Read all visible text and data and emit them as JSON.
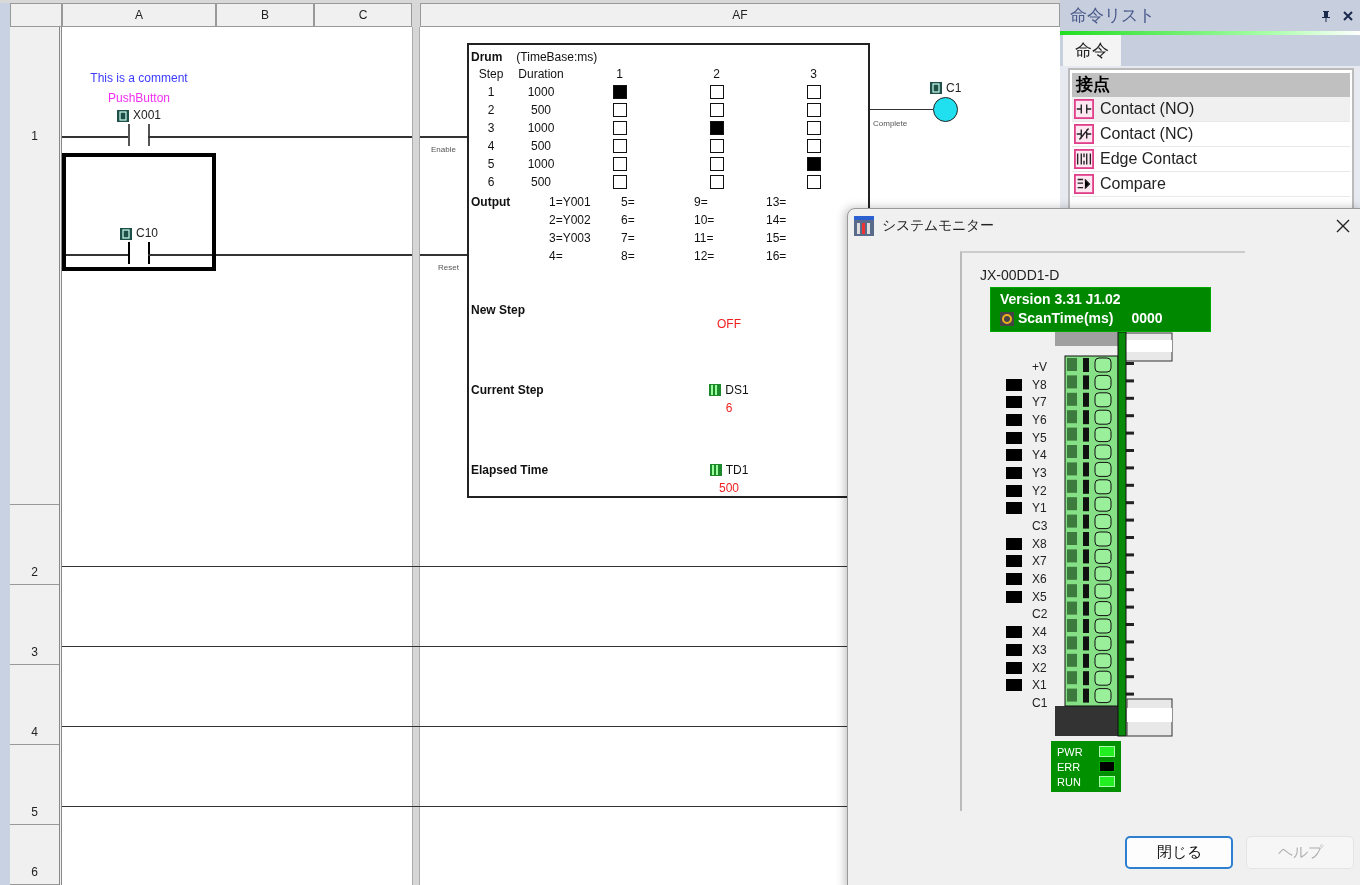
{
  "ladder": {
    "columns": [
      "A",
      "B",
      "C",
      "AF"
    ],
    "row_numbers": [
      "1",
      "2",
      "3",
      "4",
      "5",
      "6"
    ],
    "comment": "This is a comment",
    "contacts": [
      {
        "nickname": "PushButton",
        "address": "X001",
        "selected": false
      },
      {
        "address": "C10",
        "selected": true
      }
    ],
    "input_labels": [
      "Enable",
      "Reset"
    ],
    "output_label": "Complete",
    "coil": {
      "address": "C1",
      "on": true
    },
    "drum": {
      "title": "Drum",
      "time_base": "(TimeBase:ms)",
      "step_heading": "Step",
      "duration_heading": "Duration",
      "output_headings": [
        "1",
        "2",
        "3"
      ],
      "steps": [
        {
          "step": "1",
          "duration": "1000",
          "outputs": [
            true,
            false,
            false
          ]
        },
        {
          "step": "2",
          "duration": "500",
          "outputs": [
            false,
            false,
            false
          ]
        },
        {
          "step": "3",
          "duration": "1000",
          "outputs": [
            false,
            true,
            false
          ]
        },
        {
          "step": "4",
          "duration": "500",
          "outputs": [
            false,
            false,
            false
          ]
        },
        {
          "step": "5",
          "duration": "1000",
          "outputs": [
            false,
            false,
            true
          ]
        },
        {
          "step": "6",
          "duration": "500",
          "outputs": [
            false,
            false,
            false
          ]
        }
      ],
      "output_label": "Output",
      "output_map": [
        "1=Y001",
        "2=Y002",
        "3=Y003",
        "4=",
        "5=",
        "6=",
        "7=",
        "8=",
        "9=",
        "10=",
        "11=",
        "12=",
        "13=",
        "14=",
        "15=",
        "16="
      ],
      "fields": [
        {
          "label": "New Step",
          "value": "OFF"
        },
        {
          "label": "Current Step",
          "address": "DS1",
          "value": "6"
        },
        {
          "label": "Elapsed Time",
          "address": "TD1",
          "value": "500"
        }
      ]
    }
  },
  "instruction_list": {
    "title": "命令リスト",
    "tabs": [
      {
        "label": "命令",
        "selected": true
      }
    ],
    "category": "接点",
    "items": [
      {
        "label": "Contact (NO)",
        "kind": "no",
        "selected": true
      },
      {
        "label": "Contact (NC)",
        "kind": "nc",
        "selected": false
      },
      {
        "label": "Edge Contact",
        "kind": "edge",
        "selected": false
      },
      {
        "label": "Compare",
        "kind": "compare",
        "selected": false
      }
    ]
  },
  "system_monitor": {
    "title": "システムモニター",
    "model": "JX-00DD1-D",
    "version": "Version 3.31 J1.02",
    "scan_time_label": "ScanTime(ms)",
    "scan_time": "0000",
    "terminals": [
      {
        "label": "+V",
        "kind": "common"
      },
      {
        "label": "Y8",
        "kind": "io",
        "on": false
      },
      {
        "label": "Y7",
        "kind": "io",
        "on": false
      },
      {
        "label": "Y6",
        "kind": "io",
        "on": false
      },
      {
        "label": "Y5",
        "kind": "io",
        "on": false
      },
      {
        "label": "Y4",
        "kind": "io",
        "on": false
      },
      {
        "label": "Y3",
        "kind": "io",
        "on": false
      },
      {
        "label": "Y2",
        "kind": "io",
        "on": false
      },
      {
        "label": "Y1",
        "kind": "io",
        "on": false
      },
      {
        "label": "C3",
        "kind": "common"
      },
      {
        "label": "X8",
        "kind": "io",
        "on": false
      },
      {
        "label": "X7",
        "kind": "io",
        "on": false
      },
      {
        "label": "X6",
        "kind": "io",
        "on": false
      },
      {
        "label": "X5",
        "kind": "io",
        "on": false
      },
      {
        "label": "C2",
        "kind": "common"
      },
      {
        "label": "X4",
        "kind": "io",
        "on": false
      },
      {
        "label": "X3",
        "kind": "io",
        "on": false
      },
      {
        "label": "X2",
        "kind": "io",
        "on": false
      },
      {
        "label": "X1",
        "kind": "io",
        "on": false
      },
      {
        "label": "C1",
        "kind": "common"
      }
    ],
    "leds": [
      {
        "label": "PWR",
        "on": true
      },
      {
        "label": "ERR",
        "on": false
      },
      {
        "label": "RUN",
        "on": true
      }
    ],
    "buttons": [
      {
        "label": "閉じる",
        "disabled": false
      },
      {
        "label": "ヘルプ",
        "disabled": true
      }
    ]
  }
}
